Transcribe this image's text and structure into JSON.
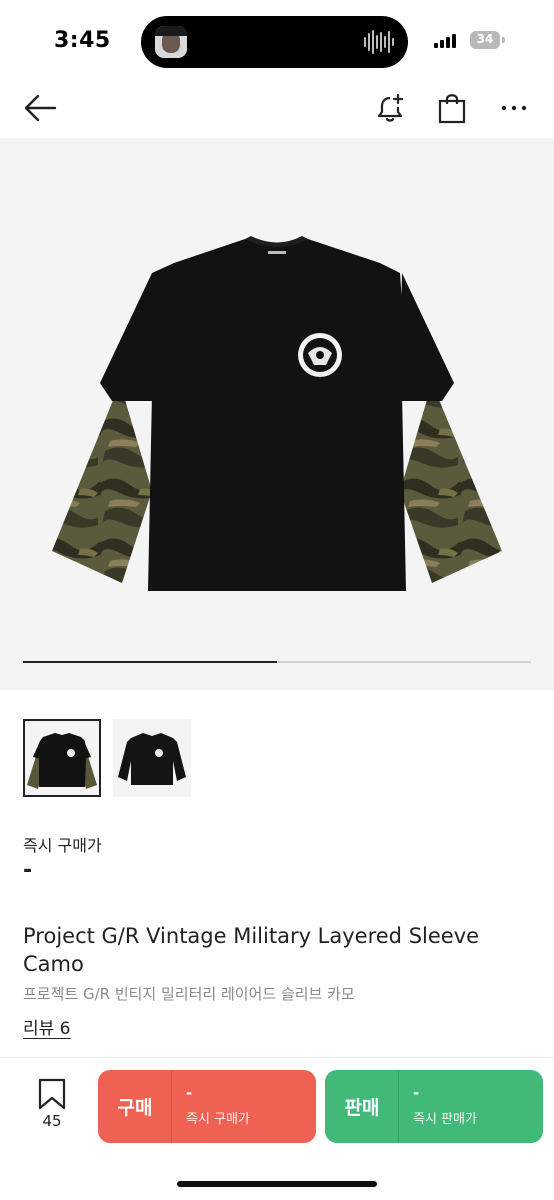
{
  "status_bar": {
    "time": "3:45",
    "battery": "34"
  },
  "header": {
    "icons": [
      "back-arrow-icon",
      "bell-plus-icon",
      "shopping-bag-icon",
      "more-icon"
    ]
  },
  "gallery": {
    "thumbnail_count": 2,
    "selected_index": 0,
    "progress": 0.5
  },
  "price": {
    "label": "즉시 구매가",
    "value": "-"
  },
  "product": {
    "title_en": "Project G/R Vintage Military Layered Sleeve Camo",
    "title_ko": "프로젝트 G/R 빈티지 밀리터리 레이어드 슬리브 카모",
    "review_link": "리뷰 6"
  },
  "bottom_bar": {
    "wish_count": "45",
    "buy": {
      "label": "구매",
      "price": "-",
      "sub": "즉시 구매가",
      "color": "#ef6253"
    },
    "sell": {
      "label": "판매",
      "price": "-",
      "sub": "즉시 판매가",
      "color": "#41b979"
    }
  }
}
